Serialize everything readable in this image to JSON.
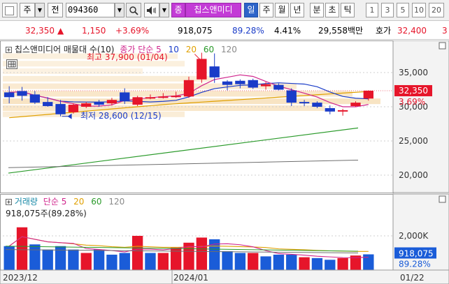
{
  "toolbar": {
    "period_select": "주",
    "prev_label": "전",
    "code_value": "094360",
    "badge_label": "종",
    "stock_name": "칩스앤미디",
    "periods": [
      "일",
      "주",
      "월",
      "년",
      "분",
      "초",
      "틱"
    ],
    "selected_period": "일",
    "numbers": [
      "1",
      "3",
      "5",
      "10",
      "20"
    ]
  },
  "quote": {
    "price": "32,350",
    "arrow": "▲",
    "change": "1,150",
    "change_pct": "+3.69%",
    "volume": "918,075",
    "volume_ratio": "89.28%",
    "turnover": "4.41%",
    "amount": "29,558백만",
    "bid_label": "호가",
    "bid_price": "32,400",
    "extra": "3"
  },
  "chart": {
    "price_legend": {
      "name": "칩스앤미디어 매물대 수(10)",
      "ma_label": "종가 단순",
      "ma_periods": [
        "5",
        "10",
        "20",
        "60",
        "120"
      ],
      "ma_colors": [
        "#e6152a",
        "#1a3cc8",
        "#e0a000",
        "#2a9a2a",
        "#8a8a8a"
      ]
    },
    "high_label": "최고 37,900 (01/04)",
    "low_label": "최저 28,600 (12/15)",
    "price_axis": [
      "35,000",
      "30,000",
      "25,000",
      "20,000"
    ],
    "current_price": "32,350",
    "current_pct": "3.69%",
    "volume_legend": {
      "name": "거래량",
      "ma_label": "단순",
      "ma_periods": [
        "5",
        "20",
        "60",
        "120"
      ]
    },
    "volume_text": "918,075주(89.28%)",
    "volume_axis": "2,000K",
    "current_volume": "918,075",
    "current_volume_pct": "89.28%",
    "date_labels": [
      "2023/12",
      "2024/01",
      "01/22"
    ]
  },
  "chart_data": {
    "type": "candlestick",
    "price_axis_ticks": [
      35000,
      30000,
      25000,
      20000
    ],
    "candles": [
      {
        "o": 31400,
        "h": 33000,
        "l": 30500,
        "c": 32100,
        "dir": "down"
      },
      {
        "o": 31600,
        "h": 32900,
        "l": 30900,
        "c": 32300,
        "dir": "down"
      },
      {
        "o": 31800,
        "h": 32300,
        "l": 30400,
        "c": 30600,
        "dir": "down"
      },
      {
        "o": 30700,
        "h": 31400,
        "l": 30000,
        "c": 30100,
        "dir": "down"
      },
      {
        "o": 30400,
        "h": 31000,
        "l": 28600,
        "c": 28900,
        "dir": "down"
      },
      {
        "o": 29200,
        "h": 30500,
        "l": 29000,
        "c": 30300,
        "dir": "up"
      },
      {
        "o": 30000,
        "h": 30700,
        "l": 29800,
        "c": 30500,
        "dir": "up"
      },
      {
        "o": 30300,
        "h": 31000,
        "l": 30000,
        "c": 30700,
        "dir": "down"
      },
      {
        "o": 30500,
        "h": 31300,
        "l": 30200,
        "c": 31000,
        "dir": "up"
      },
      {
        "o": 30800,
        "h": 32700,
        "l": 30400,
        "c": 32100,
        "dir": "down"
      },
      {
        "o": 30300,
        "h": 31600,
        "l": 30100,
        "c": 31400,
        "dir": "up"
      },
      {
        "o": 31300,
        "h": 31800,
        "l": 31100,
        "c": 31400,
        "dir": "up"
      },
      {
        "o": 31400,
        "h": 32000,
        "l": 31200,
        "c": 31500,
        "dir": "up"
      },
      {
        "o": 31500,
        "h": 32200,
        "l": 31300,
        "c": 31600,
        "dir": "up"
      },
      {
        "o": 31500,
        "h": 34400,
        "l": 31300,
        "c": 33900,
        "dir": "up"
      },
      {
        "o": 34000,
        "h": 37900,
        "l": 33500,
        "c": 37000,
        "dir": "up"
      },
      {
        "o": 34300,
        "h": 37800,
        "l": 33500,
        "c": 35900,
        "dir": "down"
      },
      {
        "o": 33700,
        "h": 33900,
        "l": 32400,
        "c": 33200,
        "dir": "down"
      },
      {
        "o": 33800,
        "h": 34000,
        "l": 32700,
        "c": 33300,
        "dir": "down"
      },
      {
        "o": 33900,
        "h": 34100,
        "l": 32600,
        "c": 32800,
        "dir": "down"
      },
      {
        "o": 33000,
        "h": 33600,
        "l": 32500,
        "c": 33300,
        "dir": "up"
      },
      {
        "o": 33200,
        "h": 33400,
        "l": 32400,
        "c": 32500,
        "dir": "down"
      },
      {
        "o": 32400,
        "h": 32700,
        "l": 30100,
        "c": 30600,
        "dir": "down"
      },
      {
        "o": 30600,
        "h": 31000,
        "l": 30100,
        "c": 30700,
        "dir": "down"
      },
      {
        "o": 30600,
        "h": 30800,
        "l": 29800,
        "c": 30000,
        "dir": "down"
      },
      {
        "o": 29800,
        "h": 30200,
        "l": 28900,
        "c": 29300,
        "dir": "down"
      },
      {
        "o": 29500,
        "h": 29700,
        "l": 28700,
        "c": 29400,
        "dir": "up"
      },
      {
        "o": 30100,
        "h": 30800,
        "l": 30000,
        "c": 30600,
        "dir": "up"
      },
      {
        "o": 31200,
        "h": 32400,
        "l": 30900,
        "c": 32350,
        "dir": "up"
      }
    ],
    "volume_axis_ticks": [
      "2,000K"
    ],
    "volumes": [
      {
        "v": 1400,
        "dir": "down"
      },
      {
        "v": 2500,
        "dir": "up"
      },
      {
        "v": 1500,
        "dir": "down"
      },
      {
        "v": 1200,
        "dir": "down"
      },
      {
        "v": 1400,
        "dir": "down"
      },
      {
        "v": 1200,
        "dir": "down"
      },
      {
        "v": 1000,
        "dir": "up"
      },
      {
        "v": 1200,
        "dir": "down"
      },
      {
        "v": 900,
        "dir": "down"
      },
      {
        "v": 1000,
        "dir": "down"
      },
      {
        "v": 2000,
        "dir": "up"
      },
      {
        "v": 1000,
        "dir": "down"
      },
      {
        "v": 1000,
        "dir": "up"
      },
      {
        "v": 1300,
        "dir": "up"
      },
      {
        "v": 1600,
        "dir": "up"
      },
      {
        "v": 1900,
        "dir": "up"
      },
      {
        "v": 1800,
        "dir": "down"
      },
      {
        "v": 1100,
        "dir": "down"
      },
      {
        "v": 1000,
        "dir": "down"
      },
      {
        "v": 1000,
        "dir": "up"
      },
      {
        "v": 800,
        "dir": "down"
      },
      {
        "v": 900,
        "dir": "down"
      },
      {
        "v": 900,
        "dir": "down"
      },
      {
        "v": 750,
        "dir": "up"
      },
      {
        "v": 700,
        "dir": "down"
      },
      {
        "v": 600,
        "dir": "down"
      },
      {
        "v": 700,
        "dir": "up"
      },
      {
        "v": 850,
        "dir": "up"
      },
      {
        "v": 918,
        "dir": "down"
      }
    ]
  }
}
